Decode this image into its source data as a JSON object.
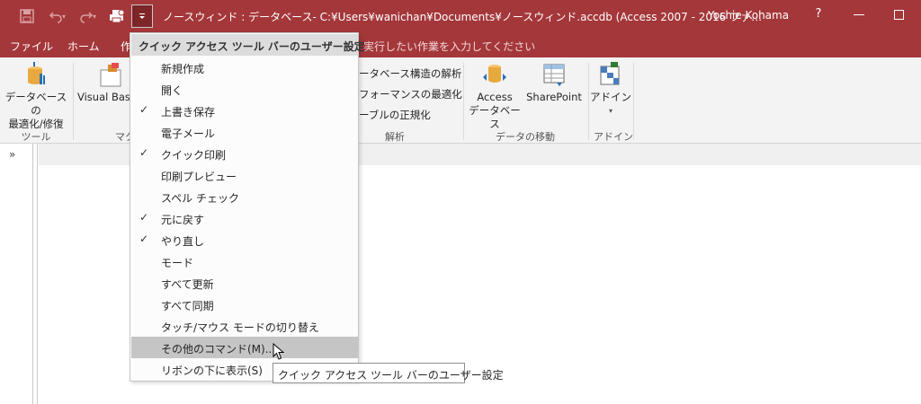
{
  "window": {
    "title": "ノースウィンド : データベース- C:¥Users¥wanichan¥Documents¥ノースウィンド.accdb (Access 2007 - 2016 ファ…",
    "user": "Yoshie Kohama",
    "help": "?"
  },
  "tabs": [
    "ファイル",
    "ホーム",
    "作"
  ],
  "tell_me": "実行したい作業を入力してください",
  "ribbon": {
    "compact_repair": "データベースの\n最適化/修復",
    "visual_basic": "Visual Bas",
    "analyze_structure": "ータベース構造の解析",
    "performance": "フォーマンスの最適化",
    "normalize": "ーブルの正規化",
    "access_db": "Access\nデータベース",
    "sharepoint": "SharePoint",
    "addins": "アドイン",
    "groups": {
      "tools": "ツール",
      "macro": "マク",
      "analyze": "解析",
      "move_data": "データの移動",
      "addins": "アドイン"
    }
  },
  "nav": {
    "toggle": "»"
  },
  "qat_menu": {
    "header": "クイック アクセス ツール バーのユーザー設定",
    "items": [
      {
        "label": "新規作成",
        "checked": false
      },
      {
        "label": "開く",
        "checked": false
      },
      {
        "label": "上書き保存",
        "checked": true
      },
      {
        "label": "電子メール",
        "checked": false
      },
      {
        "label": "クイック印刷",
        "checked": true
      },
      {
        "label": "印刷プレビュー",
        "checked": false
      },
      {
        "label": "スペル チェック",
        "checked": false
      },
      {
        "label": "元に戻す",
        "checked": true
      },
      {
        "label": "やり直し",
        "checked": true
      },
      {
        "label": "モード",
        "checked": false
      },
      {
        "label": "すべて更新",
        "checked": false
      },
      {
        "label": "すべて同期",
        "checked": false
      },
      {
        "label": "タッチ/マウス モードの切り替え",
        "checked": false
      }
    ],
    "more_commands": "その他のコマンド(M)...",
    "show_below": "リボンの下に表示(S)",
    "check_mark": "✓"
  },
  "tooltip": "クイック アクセス ツール バーのユーザー設定",
  "colors": {
    "accent": "#a4373a",
    "ribbon_bg": "#f3f3f3",
    "highlight": "#c5c5c5"
  }
}
